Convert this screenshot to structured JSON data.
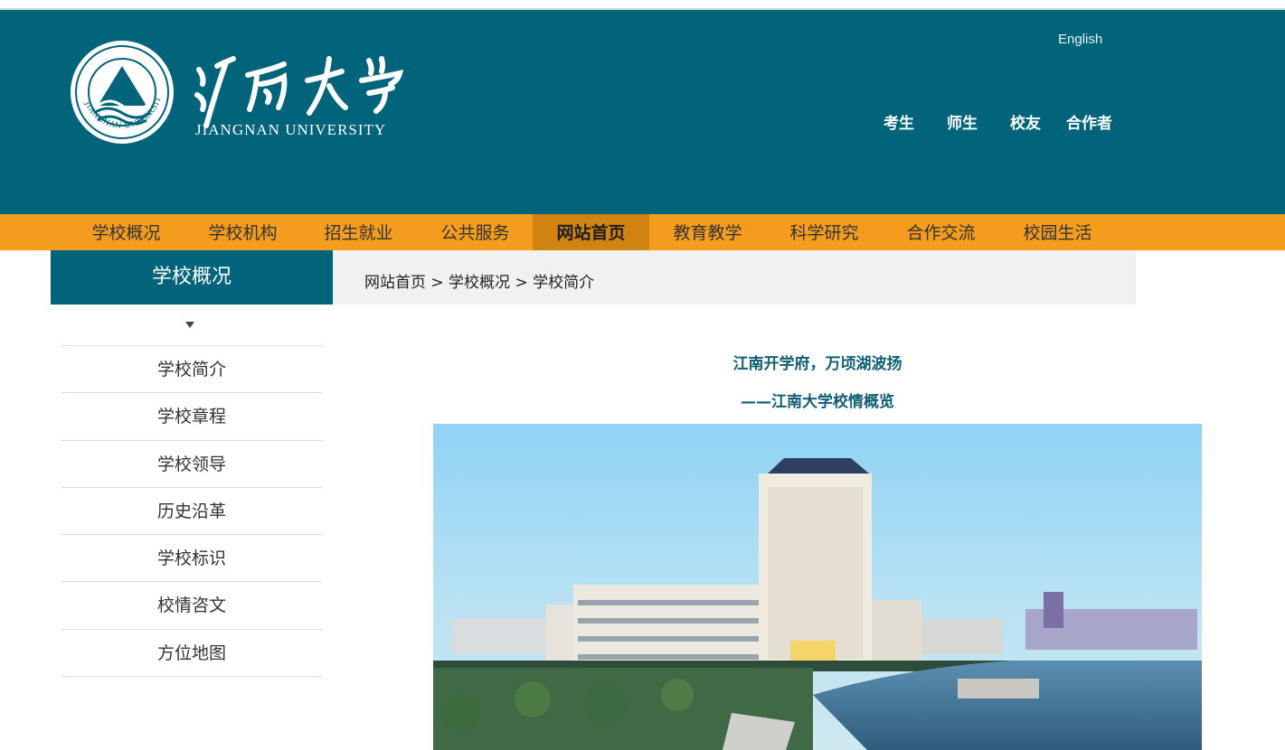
{
  "header": {
    "brand_cn": "江南大学",
    "brand_en": "JIANGNAN UNIVERSITY",
    "seal_text": "JIANGNAN UNIVERSITY",
    "language_link": "English",
    "audience_links": [
      "考生",
      "师生",
      "校友",
      "合作者"
    ]
  },
  "nav": {
    "items": [
      {
        "label": "学校概况"
      },
      {
        "label": "学校机构"
      },
      {
        "label": "招生就业"
      },
      {
        "label": "公共服务"
      },
      {
        "label": "网站首页",
        "active": true
      },
      {
        "label": "教育教学"
      },
      {
        "label": "科学研究"
      },
      {
        "label": "合作交流"
      },
      {
        "label": "校园生活"
      }
    ]
  },
  "sidebar": {
    "title": "学校概况",
    "items": [
      "学校简介",
      "学校章程",
      "学校领导",
      "历史沿革",
      "学校标识",
      "校情咨文",
      "方位地图"
    ]
  },
  "breadcrumb": "网站首页 > 学校概况 > 学校简介",
  "article": {
    "title": "江南开学府，万顷湖波扬",
    "subtitle": "——江南大学校情概览"
  },
  "colors": {
    "header_bg": "#02647a",
    "nav_bg": "#f39c1e",
    "nav_active_bg": "#d18312",
    "heading_text": "#0f5f74"
  }
}
